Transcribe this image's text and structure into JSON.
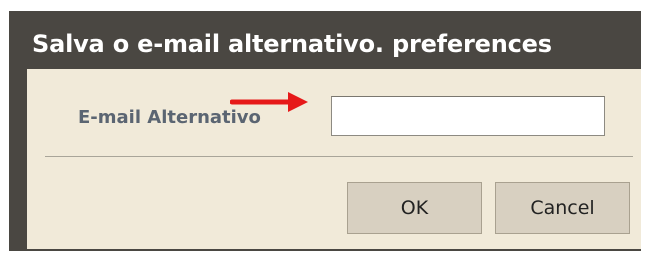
{
  "dialog": {
    "title": "Salva o e-mail alternativo. preferences",
    "field_label": "E-mail Alternativo",
    "field_value": "",
    "field_placeholder": "",
    "ok_label": "OK",
    "cancel_label": "Cancel"
  },
  "colors": {
    "frame": "#4a4742",
    "body": "#f1ead9",
    "label": "#5b6572",
    "button": "#d8d0c1",
    "arrow": "#e61919"
  },
  "icons": {
    "pointer": "red-arrow-icon"
  }
}
